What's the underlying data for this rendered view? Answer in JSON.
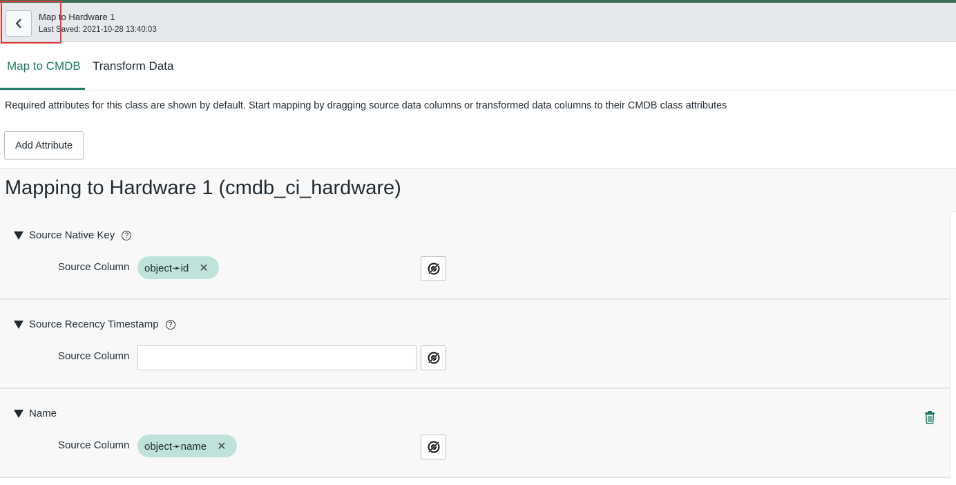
{
  "header": {
    "title": "Map to Hardware 1",
    "last_saved": "Last Saved: 2021-10-28 13:40:03",
    "back_icon": "chevron-left-icon"
  },
  "tabs": [
    {
      "label": "Map to CMDB",
      "active": true
    },
    {
      "label": "Transform Data",
      "active": false
    }
  ],
  "info_text": "Required attributes for this class are shown by default. Start mapping by dragging source data columns or transformed data columns to their CMDB class attributes",
  "add_attribute_label": "Add Attribute",
  "mapping_title": "Mapping to Hardware 1 (cmdb_ci_hardware)",
  "sections": [
    {
      "label": "Source Native Key",
      "help": "?",
      "source_label": "Source Column",
      "value": "object➛id",
      "remove": "✕"
    },
    {
      "label": "Source Recency Timestamp",
      "help": "?",
      "source_label": "Source Column",
      "value": ""
    },
    {
      "label": "Name",
      "source_label": "Source Column",
      "value": "object➛name",
      "remove": "✕"
    }
  ],
  "colors": {
    "accent": "#1c7a66",
    "pill": "#bfe3da",
    "highlight": "#e53935"
  }
}
